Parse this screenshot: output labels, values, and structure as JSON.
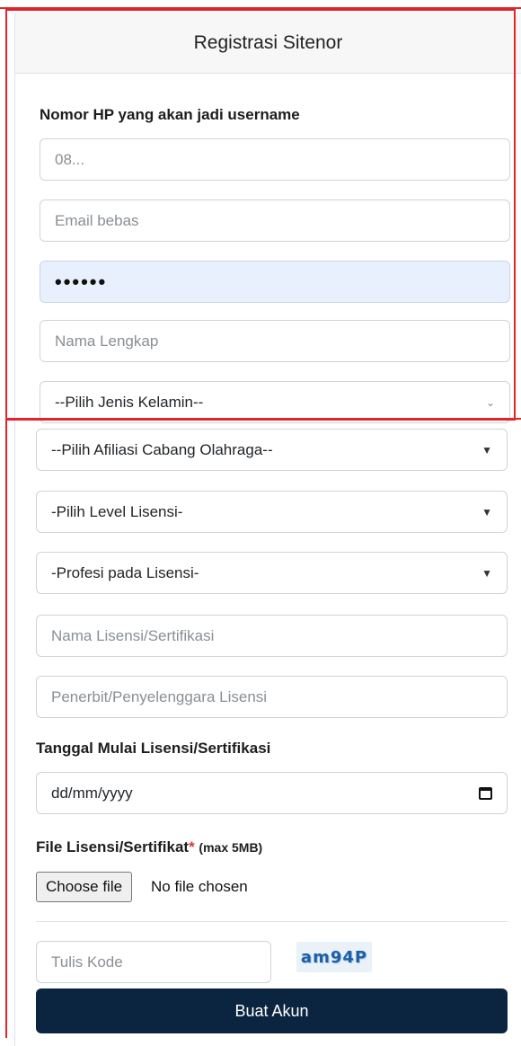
{
  "header": {
    "title": "Registrasi Sitenor"
  },
  "labels": {
    "phone": "Nomor HP yang akan jadi username",
    "start_date": "Tanggal Mulai Lisensi/Sertifikasi",
    "file": "File Lisensi/Sertifikat",
    "file_required": "*",
    "file_note": "(max 5MB)"
  },
  "fields": {
    "phone_placeholder": "08...",
    "email_placeholder": "Email bebas",
    "password_value": "••••••",
    "full_name_placeholder": "Nama Lengkap",
    "gender_select": "--Pilih Jenis Kelamin--",
    "sport_select": "--Pilih Afiliasi Cabang Olahraga--",
    "license_level_select": "-Pilih Level Lisensi-",
    "profession_select": "-Profesi pada Lisensi-",
    "license_name_placeholder": "Nama Lisensi/Sertifikasi",
    "issuer_placeholder": "Penerbit/Penyelenggara Lisensi",
    "date_value": "dd/mm/yyyy",
    "captcha_placeholder": "Tulis Kode"
  },
  "file_input": {
    "button_label": "Choose file",
    "status": "No file chosen"
  },
  "captcha": {
    "code": "am94P"
  },
  "submit_label": "Buat Akun",
  "colors": {
    "annotation_red": "#e0252b",
    "submit_bg": "#0b2541",
    "autofill_bg": "#e8f0fe"
  },
  "icons": {
    "select_arrow": "caret-down-icon",
    "chevron": "chevron-down-icon",
    "calendar": "calendar-icon"
  }
}
